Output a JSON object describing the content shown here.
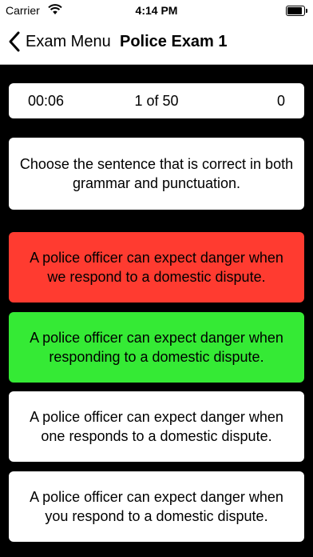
{
  "status_bar": {
    "carrier": "Carrier",
    "time": "4:14 PM"
  },
  "nav": {
    "back_label": "Exam Menu",
    "title": "Police Exam 1"
  },
  "stats": {
    "timer": "00:06",
    "progress": "1 of 50",
    "score": "0"
  },
  "question": {
    "text": "Choose the sentence that is correct in both grammar and punctuation."
  },
  "answers": [
    {
      "text": "A police officer can expect danger when we respond to a domestic dispute.",
      "state": "incorrect",
      "color": "#ff3b30"
    },
    {
      "text": "A police officer can expect danger when responding to a domestic dispute.",
      "state": "correct",
      "color": "#35ea35"
    },
    {
      "text": "A police officer can expect danger when one responds to a domestic dispute.",
      "state": "neutral",
      "color": "#ffffff"
    },
    {
      "text": "A police officer can expect danger when you respond to a domestic dispute.",
      "state": "neutral",
      "color": "#ffffff"
    }
  ]
}
